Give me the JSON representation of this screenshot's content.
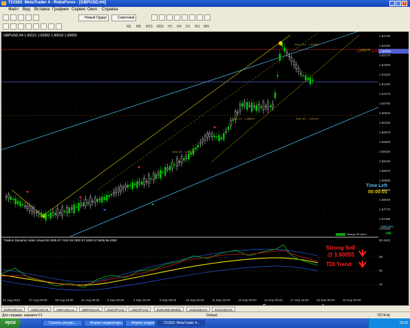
{
  "window": {
    "title": "721563: MetaTrader 4 - RoboForex - [GBPUSD,H4]",
    "buttons": [
      "_",
      "□",
      "×"
    ]
  },
  "menu": [
    "Файл",
    "Вид",
    "Вставка",
    "Графики",
    "Сервис",
    "Окно",
    "Справка"
  ],
  "toolbar": {
    "new_order": "Новый Ордер",
    "advisors": "Советники",
    "timeframes": [
      "M1",
      "M5",
      "M15",
      "M30",
      "H1",
      "H4",
      "D1",
      "W1",
      "MN"
    ]
  },
  "chart": {
    "label": "GBPUSD,H4  1.60121 1.60262 1.60010 1.60055",
    "price_labels": [
      "1.62720",
      "1.62440",
      "1.62170",
      "1.61900",
      "1.61620",
      "1.61340",
      "1.61070",
      "1.60790",
      "1.60520",
      "1.60240",
      "1.59970",
      "1.59690",
      "1.59420",
      "1.59140",
      "1.58870",
      "1.58590",
      "1.58320",
      "1.58040",
      "1.57770",
      "1.57490",
      "1.57220"
    ],
    "current_price": "1.60055",
    "resistance_tag": "1.62170",
    "fib_labels": [
      "Zero 3.11 - 1.61940",
      "Zero 1/1 - 1.60650",
      "Zero 3/1 - 1.59120",
      "Zero 2/1 - 1.58820",
      "Zero 3/1 - 1.58010"
    ],
    "time_left_label": "Time Left",
    "time_left_value": "00:00:01",
    "strong_label": "Strong UP trend",
    "strong_value": "+90",
    "gbpusd_tag": "GBPUSD",
    "time_labels": [
      "21 Aug 2012",
      "27 Aug 00:00",
      "29 Aug 16:00",
      "31 Aug 08:00",
      "3 Sep 00:00",
      "4 Sep 16:00",
      "6 Sep 08:00",
      "10 Sep 00:00",
      "11 Sep 16:00",
      "13 Sep 08:00",
      "14 Sep 00:00",
      "17 Sep 16:00",
      "19 Sep 08:00",
      "20 Sep 00:00"
    ]
  },
  "indicator": {
    "label": "Traders Dynamic Index Visual 92.2935 67.7442 53.1902 57.3400 57.9406 66.2382",
    "levels": [
      "80.4622",
      "68",
      "50",
      "32"
    ],
    "signal_line1": "Strong Sell",
    "signal_line2": "@ 1.60055",
    "trend_label": "TDI Trend"
  },
  "tabs": [
    "EURUSD,H4",
    "USDCHF,H4",
    "GBPUSD,H4",
    "GBPAUD,H4",
    "EURJPY,H4",
    "USDJPY,H4",
    "EURUSD,Weekly",
    "AUDUSD,H4",
    "XAUUSD,H4"
  ],
  "active_tab": "GBPUSD,H4",
  "status": {
    "help": "Для справки, нажмите F1",
    "profile": "Default",
    "conn": "707/4 kb"
  },
  "taskbar": {
    "start": "пуск",
    "tasks": [
      "Скачать ресурс...",
      "Форекс индикаторы...",
      "Форекс индикаторы...",
      "721563: MetaTrader 4..."
    ],
    "clock": "19:32"
  },
  "watermark": "forex.osobye.ru",
  "colors": {
    "chart_bg": "#000000",
    "bull_candle": "#00cc00",
    "bear_candle": "#ffffff",
    "channel": "#48b8e8",
    "fib": "#e8d000",
    "signal": "#ff2020",
    "time_left": "#48b8e8"
  }
}
